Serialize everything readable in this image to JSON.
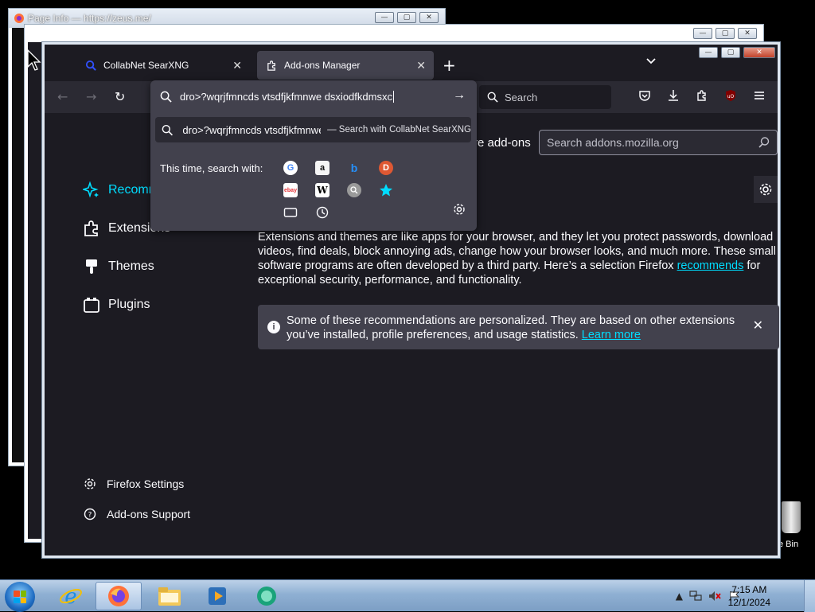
{
  "background_windows": {
    "page_info_title": "Page Info — https://zeus.me/"
  },
  "window": {
    "controls": {
      "minimize": "—",
      "maximize": "▢",
      "close": "✕"
    }
  },
  "tabs": [
    {
      "label": "CollabNet SearXNG",
      "close": "✕",
      "icon": "search-icon"
    },
    {
      "label": "Add-ons Manager",
      "close": "✕",
      "icon": "puzzle-icon"
    }
  ],
  "tabbar": {
    "new_tab": "+",
    "list_all": "⌄"
  },
  "navbar": {
    "back": "←",
    "forward": "→",
    "reload": "↻",
    "search_placeholder": "Search"
  },
  "urlbar": {
    "value": "dro>?wqrjfmncds vtsdfjkfmnwe dsxiodfkdmsxc",
    "go_arrow": "→",
    "suggestion_query": "dro>?wqrjfmncds vtsdfjkfmnwe dsxiodfkdmsxc",
    "suggestion_action": "— Search with CollabNet SearXNG",
    "this_time_label": "This time, search with:",
    "engines": [
      "google-icon",
      "amazon-icon",
      "bing-icon",
      "duckduckgo-icon",
      "ebay-icon",
      "wikipedia-icon",
      "searxng-icon",
      "bookmarks-icon",
      "tabs-icon",
      "history-icon",
      "settings-icon"
    ]
  },
  "sidebar": {
    "items": [
      {
        "label": "Recommendations",
        "icon": "sparkle-icon",
        "active": true
      },
      {
        "label": "Extensions",
        "icon": "puzzle-icon"
      },
      {
        "label": "Themes",
        "icon": "brush-icon"
      },
      {
        "label": "Plugins",
        "icon": "plugin-icon"
      }
    ],
    "footer": [
      {
        "label": "Firefox Settings",
        "icon": "gear-icon"
      },
      {
        "label": "Add-ons Support",
        "icon": "help-icon"
      }
    ]
  },
  "main": {
    "find_more": "re add-ons",
    "amo_search_placeholder": "Search addons.mozilla.org",
    "intro_text_1": "Extensions and themes are like apps for your browser, and they let you protect passwords, download videos, find deals, block annoying ads, change how your browser looks, and much more. These small software programs are often developed by a third party. Here’s a selection Firefox ",
    "intro_link": "recommends",
    "intro_text_2": " for exceptional security, performance, and functionality.",
    "notice_text": "Some of these recommendations are personalized. They are based on other extensions you’ve installed, profile preferences, and usage statistics. ",
    "notice_link": "Learn more",
    "notice_close": "✕"
  },
  "desktop": {
    "recycle_bin_label": "e Bin"
  },
  "taskbar": {
    "time": "7:15 AM",
    "date": "12/1/2024",
    "apps": [
      "ie-icon",
      "firefox-icon",
      "explorer-icon",
      "media-player-icon",
      "messenger-icon"
    ]
  },
  "colors": {
    "accent": "#00ddff",
    "content_bg": "#1c1b22",
    "toolbar_bg": "#2b2a33",
    "popup_bg": "#42414d"
  }
}
